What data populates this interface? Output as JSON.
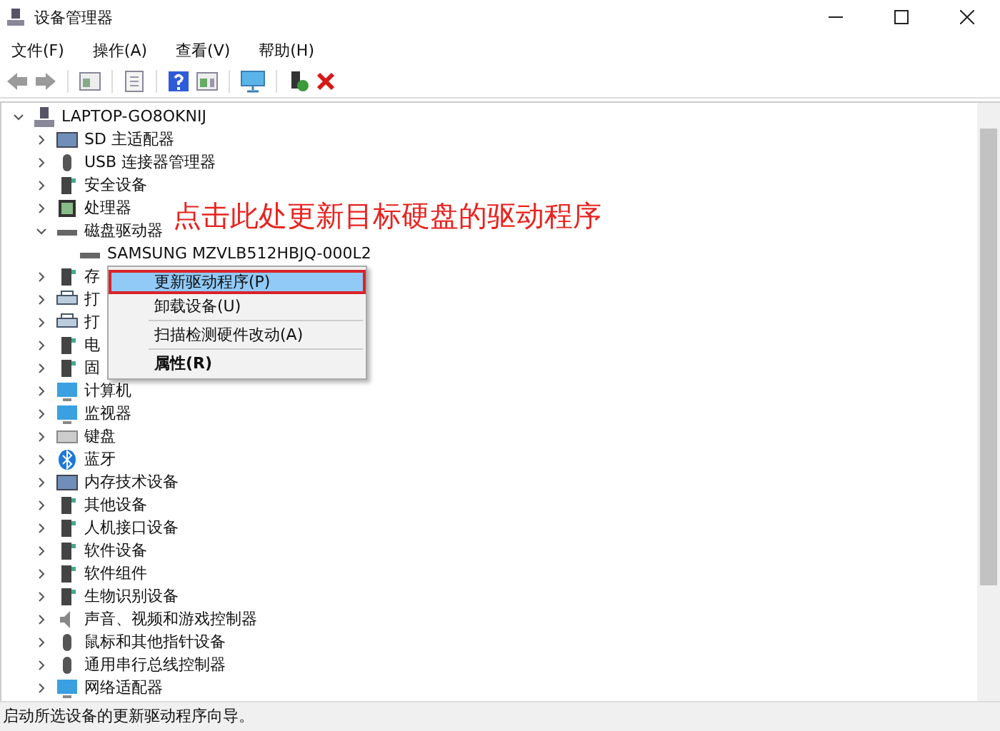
{
  "window": {
    "title": "设备管理器"
  },
  "menu": [
    "文件(F)",
    "操作(A)",
    "查看(V)",
    "帮助(H)"
  ],
  "tree": {
    "label": "LAPTOP-GO8OKNIJ",
    "expanded": true,
    "children": [
      {
        "label": "SD 主适配器",
        "expanded": false
      },
      {
        "label": "USB 连接器管理器",
        "expanded": false
      },
      {
        "label": "安全设备",
        "expanded": false
      },
      {
        "label": "处理器",
        "expanded": false
      },
      {
        "label": "磁盘驱动器",
        "expanded": true,
        "children": [
          {
            "label": "SAMSUNG MZVLB512HBJQ-000L2"
          }
        ]
      },
      {
        "label": "存",
        "expanded": false
      },
      {
        "label": "打",
        "expanded": false
      },
      {
        "label": "打",
        "expanded": false
      },
      {
        "label": "电",
        "expanded": false
      },
      {
        "label": "固",
        "expanded": false
      },
      {
        "label": "计算机",
        "expanded": false
      },
      {
        "label": "监视器",
        "expanded": false
      },
      {
        "label": "键盘",
        "expanded": false
      },
      {
        "label": "蓝牙",
        "expanded": false
      },
      {
        "label": "内存技术设备",
        "expanded": false
      },
      {
        "label": "其他设备",
        "expanded": false
      },
      {
        "label": "人机接口设备",
        "expanded": false
      },
      {
        "label": "软件设备",
        "expanded": false
      },
      {
        "label": "软件组件",
        "expanded": false
      },
      {
        "label": "生物识别设备",
        "expanded": false
      },
      {
        "label": "声音、视频和游戏控制器",
        "expanded": false
      },
      {
        "label": "鼠标和其他指针设备",
        "expanded": false
      },
      {
        "label": "通用串行总线控制器",
        "expanded": false
      },
      {
        "label": "网络适配器",
        "expanded": false
      }
    ]
  },
  "context_menu": [
    {
      "kind": "item",
      "label": "更新驱动程序(P)",
      "selected": true
    },
    {
      "kind": "item",
      "label": "卸载设备(U)",
      "selected": false
    },
    {
      "kind": "separator"
    },
    {
      "kind": "item",
      "label": "扫描检测硬件改动(A)",
      "selected": false
    },
    {
      "kind": "separator"
    },
    {
      "kind": "default",
      "label": "属性(R)",
      "selected": false
    }
  ],
  "annotation": "点击此处更新目标硬盘的驱动程序",
  "status_bar": "启动所选设备的更新驱动程序向导。"
}
